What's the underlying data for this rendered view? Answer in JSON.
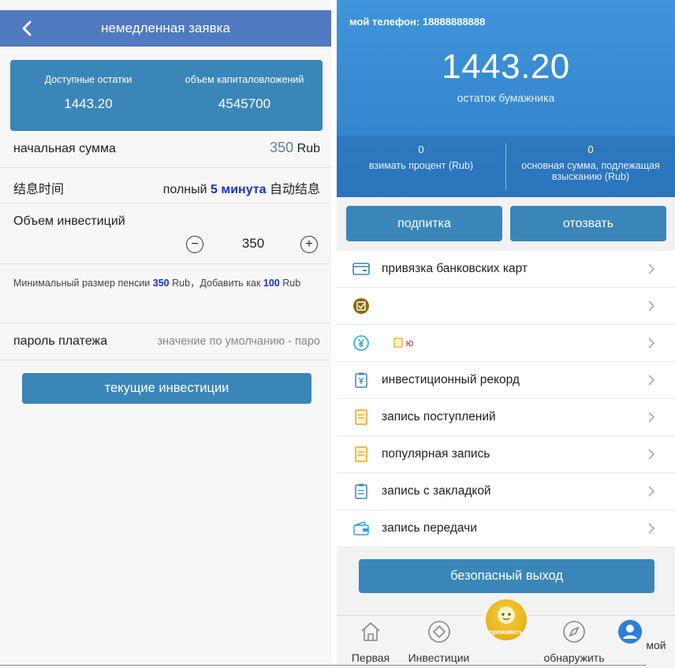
{
  "left": {
    "header": {
      "title": "немедленная заявка"
    },
    "stats": [
      {
        "label": "Доступные остатки",
        "value": "1443.20"
      },
      {
        "label": "объем капиталовложений",
        "value": "4545700"
      }
    ],
    "initial_amount": {
      "label": "начальная сумма",
      "value": "350",
      "unit": "Rub"
    },
    "interest_time": {
      "label": "结息时间",
      "prefix": "полный",
      "highlight": "5 минута",
      "suffix": "自动结息"
    },
    "investment_volume": {
      "label": "Объем инвестиций",
      "value": "350",
      "minus": "−",
      "plus": "+"
    },
    "note": {
      "text1": "Минимальный размер пенсии",
      "min": "350",
      "text2": "Rub，Добавить как",
      "step": "100",
      "text3": "Rub"
    },
    "payment_password": {
      "label": "пароль платежа",
      "placeholder": "значение по умолчанию - паро"
    },
    "invest_button": "текущие инвестиции"
  },
  "right": {
    "phone": "мой телефон: 18888888888",
    "balance": "1443.20",
    "balance_label": "остаток бумажника",
    "stats": [
      {
        "value": "0",
        "label": "взимать процент (Rub)"
      },
      {
        "value": "0",
        "label": "основная сумма, подлежащая взысканию (Rub)"
      }
    ],
    "actions": {
      "topup": "подпитка",
      "withdraw": "отозвать"
    },
    "menu": [
      {
        "label": "привязка банковских карт",
        "icon": "bank-card-icon"
      },
      {
        "label": "",
        "icon": "checkbox-badge-icon"
      },
      {
        "label": "ю",
        "icon": "yuan-icon"
      },
      {
        "label": "инвестиционный рекорд",
        "icon": "clipboard-yuan-icon"
      },
      {
        "label": "запись поступлений",
        "icon": "note-icon"
      },
      {
        "label": "популярная запись",
        "icon": "note-icon"
      },
      {
        "label": "запись с закладкой",
        "icon": "clipboard-icon"
      },
      {
        "label": "запись передачи",
        "icon": "wallet-icon"
      }
    ],
    "logout": "безопасный выход",
    "tabs": {
      "home": "Первая",
      "invest": "Инвестиции",
      "center": "проживать",
      "discover": "обнаружить",
      "mine": "мой"
    }
  },
  "colors": {
    "header": "#5079c0",
    "primary": "#3a86b9",
    "highlight": "#1b2fd6",
    "wallet_top": "#3f94dc"
  }
}
